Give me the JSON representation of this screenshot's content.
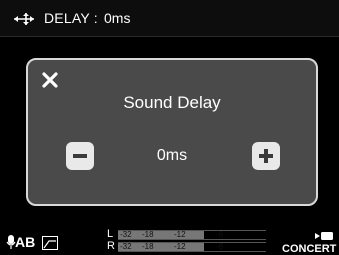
{
  "header": {
    "icon": "input-output-arrows-icon",
    "label": "DELAY :",
    "value": "0ms"
  },
  "dialog": {
    "title": "Sound Delay",
    "value": "0ms",
    "close_icon": "close-x-icon",
    "minus_icon": "minus-icon",
    "plus_icon": "plus-icon"
  },
  "status": {
    "mic_icon": "microphone-icon",
    "mode": "AB",
    "curve_icon": "lowcut-curve-icon",
    "left_channel": "L",
    "right_channel": "R",
    "scale_ticks": [
      "-32",
      "-18",
      "-12",
      "-6"
    ],
    "level_left": 0.58,
    "level_right": 0.58,
    "camera_icon": "camera-icon",
    "scene": "CONCERT"
  },
  "colors": {
    "dialog_bg": "#4a4a4a",
    "dialog_border": "#d9d9d9",
    "button_bg": "#e9e9e9"
  }
}
